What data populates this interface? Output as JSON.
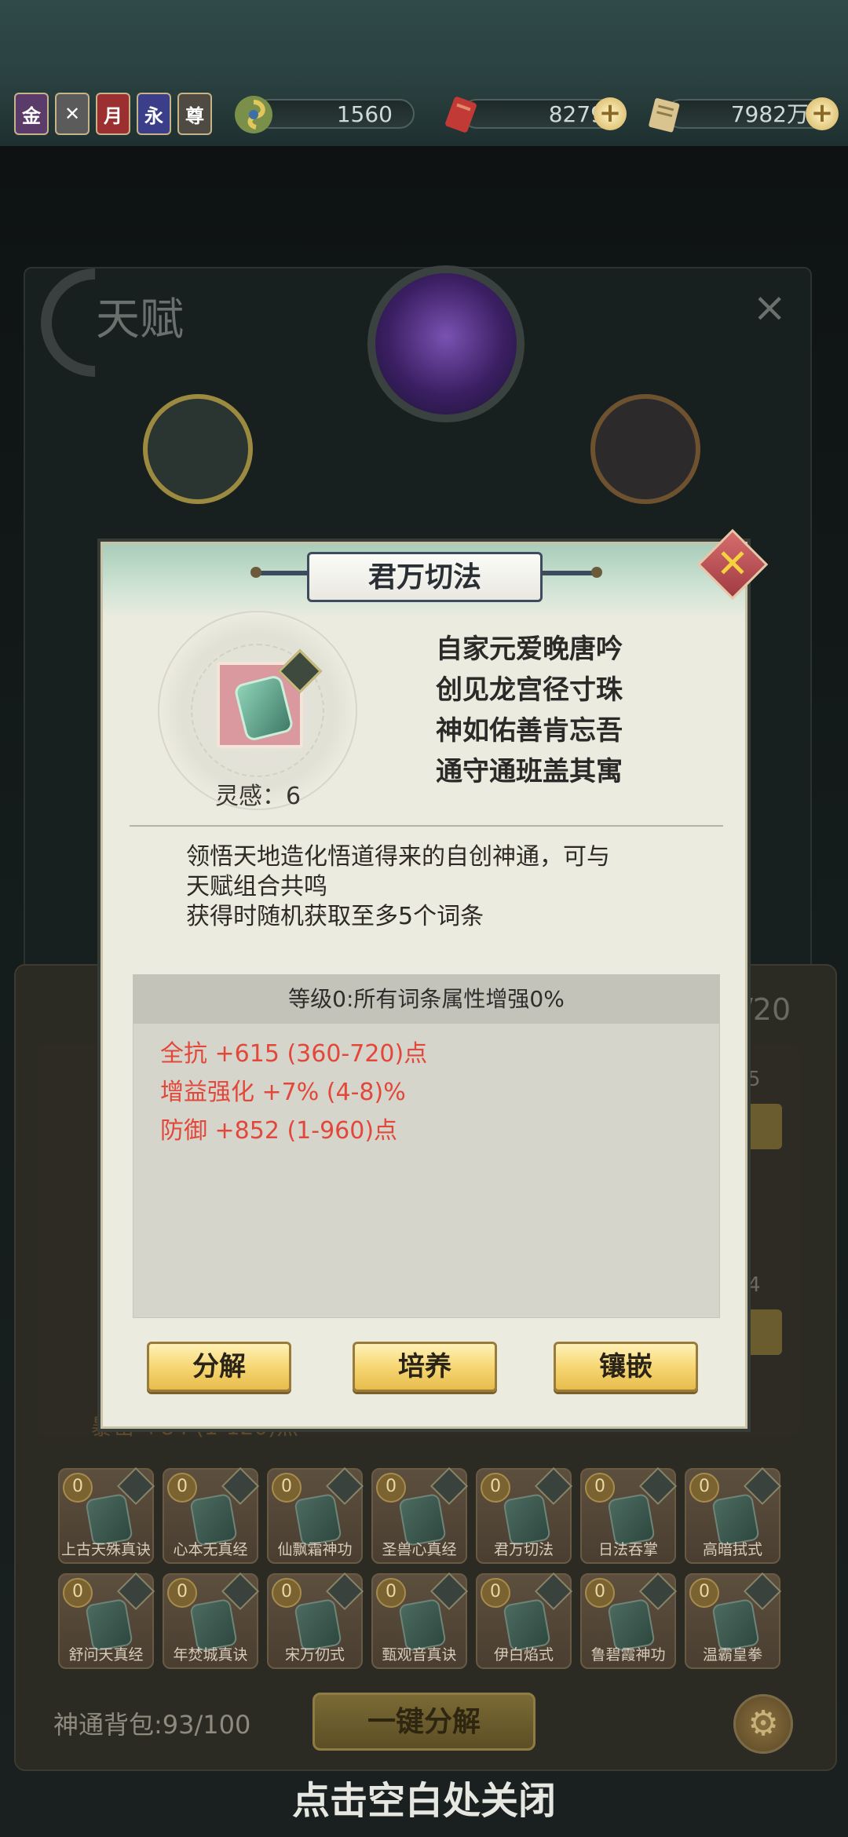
{
  "resources": {
    "jade": "1560",
    "scroll": "8279",
    "silver": "7982万"
  },
  "status_icons": [
    "金",
    "✕",
    "月",
    "永",
    "尊"
  ],
  "background": {
    "talent_title": "天赋",
    "talent_close": "×",
    "bag_count": "/20",
    "count_5": "5",
    "count_4": "4",
    "partial_text": "暴击 +84 (1-120)点",
    "bag_label": "神通背包:93/100",
    "oneclick_label": "一键分解",
    "close_hint": "点击空白处关闭"
  },
  "grid_items": [
    {
      "level": "0",
      "name": "上古天殊真诀"
    },
    {
      "level": "0",
      "name": "心本无真经"
    },
    {
      "level": "0",
      "name": "仙飘霜神功"
    },
    {
      "level": "0",
      "name": "圣兽心真经"
    },
    {
      "level": "0",
      "name": "君万切法"
    },
    {
      "level": "0",
      "name": "日法吞掌"
    },
    {
      "level": "0",
      "name": "高暗拭式"
    },
    {
      "level": "0",
      "name": "舒问天真经"
    },
    {
      "level": "0",
      "name": "年焚城真诀"
    },
    {
      "level": "0",
      "name": "宋万仞式"
    },
    {
      "level": "0",
      "name": "甄观音真诀"
    },
    {
      "level": "0",
      "name": "伊白焰式"
    },
    {
      "level": "0",
      "name": "鲁碧霞神功"
    },
    {
      "level": "0",
      "name": "温霸皇拳"
    }
  ],
  "modal": {
    "title": "君万切法",
    "inspire": "灵感：6",
    "poem": [
      "自家元爱晚唐吟",
      "创见龙宫径寸珠",
      "神如佑善肯忘吾",
      "通守通班盖其寓"
    ],
    "description": [
      "领悟天地造化悟道得来的自创神通，可与",
      "天赋组合共鸣",
      "获得时随机获取至多5个词条"
    ],
    "attr_header": "等级0:所有词条属性增强0%",
    "attributes": [
      "全抗 +615 (360-720)点",
      "增益强化 +7% (4-8)%",
      "防御 +852 (1-960)点"
    ],
    "buttons": {
      "decompose": "分解",
      "cultivate": "培养",
      "inlay": "镶嵌"
    }
  }
}
